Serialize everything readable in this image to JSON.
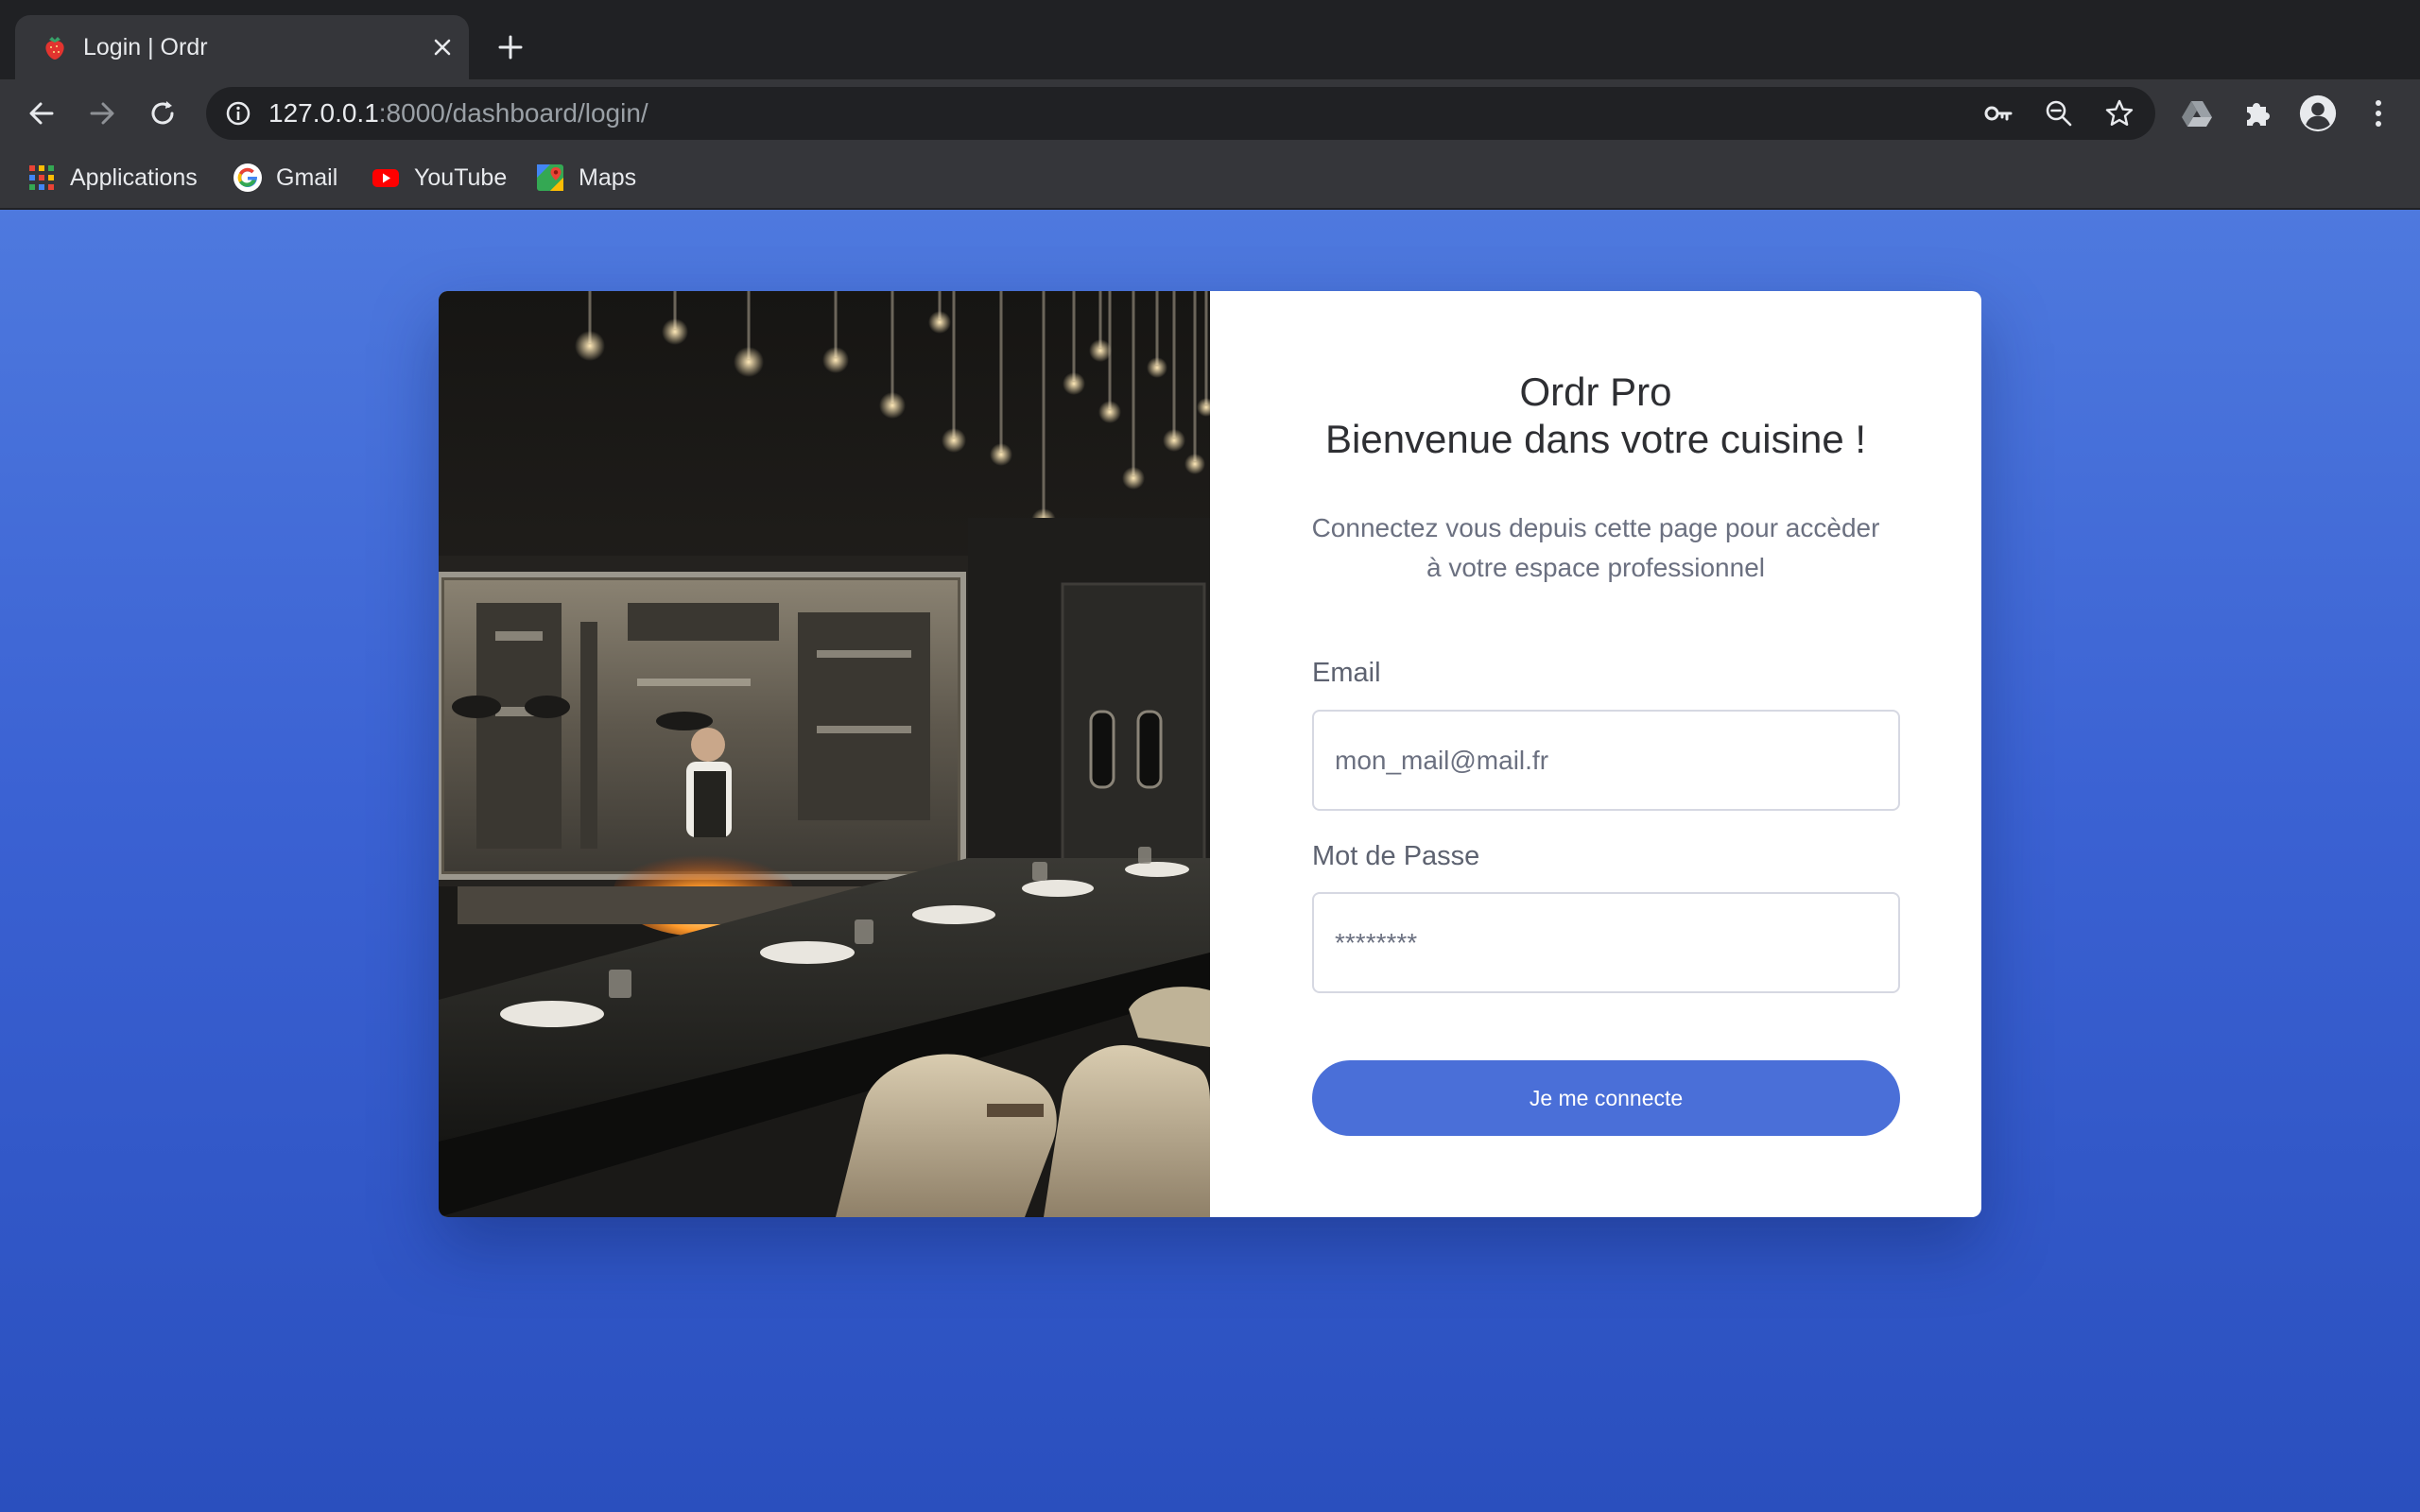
{
  "browser": {
    "tab": {
      "title": "Login | Ordr",
      "favicon": "strawberry-icon"
    },
    "address": {
      "host": "127.0.0.1",
      "rest": ":8000/dashboard/login/"
    },
    "bookmarks": [
      {
        "label": "Applications",
        "icon": "apps-grid-icon"
      },
      {
        "label": "Gmail",
        "icon": "google-icon"
      },
      {
        "label": "YouTube",
        "icon": "youtube-icon"
      },
      {
        "label": "Maps",
        "icon": "maps-icon"
      }
    ]
  },
  "login": {
    "title_line1": "Ordr Pro",
    "title_line2": "Bienvenue dans votre cuisine !",
    "subtitle_line1": "Connectez vous depuis cette page pour accèder",
    "subtitle_line2": "à votre espace professionnel",
    "email_label": "Email",
    "email_placeholder": "mon_mail@mail.fr",
    "password_label": "Mot de Passe",
    "password_placeholder": "********",
    "submit_label": "Je me connecte"
  },
  "colors": {
    "page_gradient_top": "#4e79de",
    "page_gradient_bottom": "#2a4fbe",
    "button": "#4a6fd8",
    "chrome_dark": "#202124",
    "chrome_toolbar": "#35363a"
  }
}
